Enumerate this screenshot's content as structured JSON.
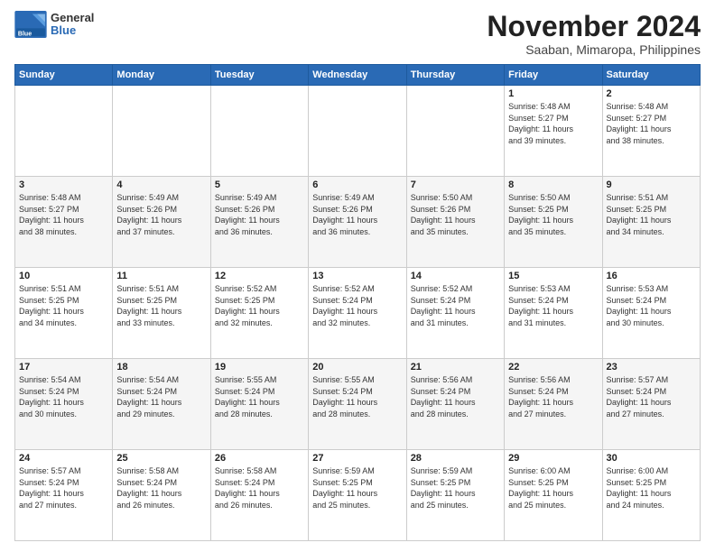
{
  "logo": {
    "general": "General",
    "blue": "Blue"
  },
  "title": "November 2024",
  "subtitle": "Saaban, Mimaropa, Philippines",
  "days_header": [
    "Sunday",
    "Monday",
    "Tuesday",
    "Wednesday",
    "Thursday",
    "Friday",
    "Saturday"
  ],
  "weeks": [
    [
      {
        "day": "",
        "info": ""
      },
      {
        "day": "",
        "info": ""
      },
      {
        "day": "",
        "info": ""
      },
      {
        "day": "",
        "info": ""
      },
      {
        "day": "",
        "info": ""
      },
      {
        "day": "1",
        "info": "Sunrise: 5:48 AM\nSunset: 5:27 PM\nDaylight: 11 hours\nand 39 minutes."
      },
      {
        "day": "2",
        "info": "Sunrise: 5:48 AM\nSunset: 5:27 PM\nDaylight: 11 hours\nand 38 minutes."
      }
    ],
    [
      {
        "day": "3",
        "info": "Sunrise: 5:48 AM\nSunset: 5:27 PM\nDaylight: 11 hours\nand 38 minutes."
      },
      {
        "day": "4",
        "info": "Sunrise: 5:49 AM\nSunset: 5:26 PM\nDaylight: 11 hours\nand 37 minutes."
      },
      {
        "day": "5",
        "info": "Sunrise: 5:49 AM\nSunset: 5:26 PM\nDaylight: 11 hours\nand 36 minutes."
      },
      {
        "day": "6",
        "info": "Sunrise: 5:49 AM\nSunset: 5:26 PM\nDaylight: 11 hours\nand 36 minutes."
      },
      {
        "day": "7",
        "info": "Sunrise: 5:50 AM\nSunset: 5:26 PM\nDaylight: 11 hours\nand 35 minutes."
      },
      {
        "day": "8",
        "info": "Sunrise: 5:50 AM\nSunset: 5:25 PM\nDaylight: 11 hours\nand 35 minutes."
      },
      {
        "day": "9",
        "info": "Sunrise: 5:51 AM\nSunset: 5:25 PM\nDaylight: 11 hours\nand 34 minutes."
      }
    ],
    [
      {
        "day": "10",
        "info": "Sunrise: 5:51 AM\nSunset: 5:25 PM\nDaylight: 11 hours\nand 34 minutes."
      },
      {
        "day": "11",
        "info": "Sunrise: 5:51 AM\nSunset: 5:25 PM\nDaylight: 11 hours\nand 33 minutes."
      },
      {
        "day": "12",
        "info": "Sunrise: 5:52 AM\nSunset: 5:25 PM\nDaylight: 11 hours\nand 32 minutes."
      },
      {
        "day": "13",
        "info": "Sunrise: 5:52 AM\nSunset: 5:24 PM\nDaylight: 11 hours\nand 32 minutes."
      },
      {
        "day": "14",
        "info": "Sunrise: 5:52 AM\nSunset: 5:24 PM\nDaylight: 11 hours\nand 31 minutes."
      },
      {
        "day": "15",
        "info": "Sunrise: 5:53 AM\nSunset: 5:24 PM\nDaylight: 11 hours\nand 31 minutes."
      },
      {
        "day": "16",
        "info": "Sunrise: 5:53 AM\nSunset: 5:24 PM\nDaylight: 11 hours\nand 30 minutes."
      }
    ],
    [
      {
        "day": "17",
        "info": "Sunrise: 5:54 AM\nSunset: 5:24 PM\nDaylight: 11 hours\nand 30 minutes."
      },
      {
        "day": "18",
        "info": "Sunrise: 5:54 AM\nSunset: 5:24 PM\nDaylight: 11 hours\nand 29 minutes."
      },
      {
        "day": "19",
        "info": "Sunrise: 5:55 AM\nSunset: 5:24 PM\nDaylight: 11 hours\nand 28 minutes."
      },
      {
        "day": "20",
        "info": "Sunrise: 5:55 AM\nSunset: 5:24 PM\nDaylight: 11 hours\nand 28 minutes."
      },
      {
        "day": "21",
        "info": "Sunrise: 5:56 AM\nSunset: 5:24 PM\nDaylight: 11 hours\nand 28 minutes."
      },
      {
        "day": "22",
        "info": "Sunrise: 5:56 AM\nSunset: 5:24 PM\nDaylight: 11 hours\nand 27 minutes."
      },
      {
        "day": "23",
        "info": "Sunrise: 5:57 AM\nSunset: 5:24 PM\nDaylight: 11 hours\nand 27 minutes."
      }
    ],
    [
      {
        "day": "24",
        "info": "Sunrise: 5:57 AM\nSunset: 5:24 PM\nDaylight: 11 hours\nand 27 minutes."
      },
      {
        "day": "25",
        "info": "Sunrise: 5:58 AM\nSunset: 5:24 PM\nDaylight: 11 hours\nand 26 minutes."
      },
      {
        "day": "26",
        "info": "Sunrise: 5:58 AM\nSunset: 5:24 PM\nDaylight: 11 hours\nand 26 minutes."
      },
      {
        "day": "27",
        "info": "Sunrise: 5:59 AM\nSunset: 5:25 PM\nDaylight: 11 hours\nand 25 minutes."
      },
      {
        "day": "28",
        "info": "Sunrise: 5:59 AM\nSunset: 5:25 PM\nDaylight: 11 hours\nand 25 minutes."
      },
      {
        "day": "29",
        "info": "Sunrise: 6:00 AM\nSunset: 5:25 PM\nDaylight: 11 hours\nand 25 minutes."
      },
      {
        "day": "30",
        "info": "Sunrise: 6:00 AM\nSunset: 5:25 PM\nDaylight: 11 hours\nand 24 minutes."
      }
    ]
  ]
}
